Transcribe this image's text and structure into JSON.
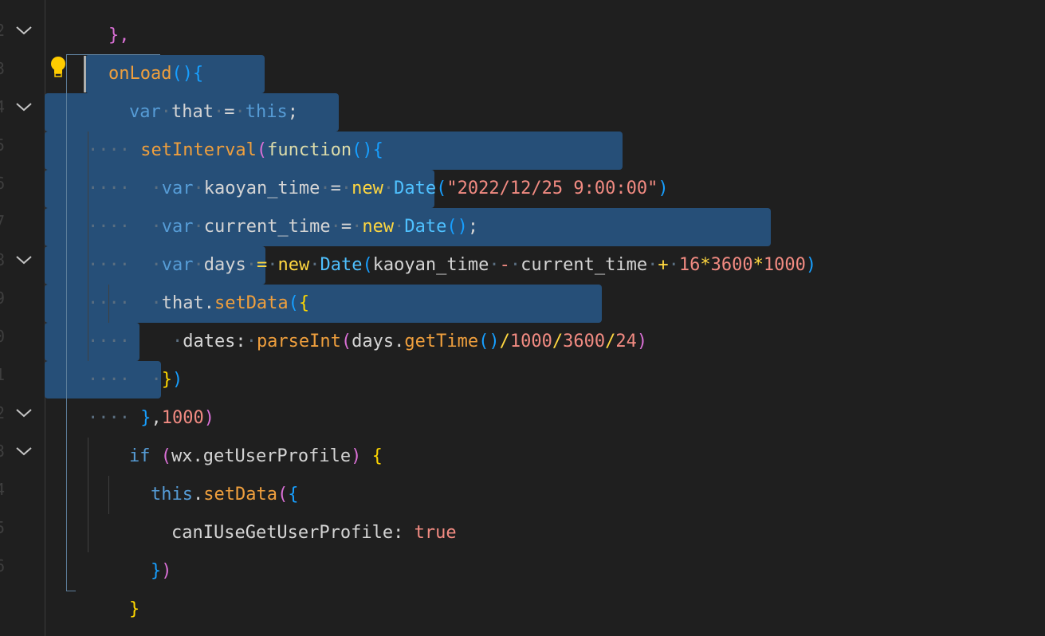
{
  "editor": {
    "language": "javascript",
    "line_numbers": [
      "2",
      "3",
      "4",
      "5",
      "6",
      "7",
      "8",
      "9",
      "0",
      "1",
      "2",
      "3",
      "4",
      "5",
      "6"
    ],
    "lines": [
      {
        "indent": 1,
        "text": "onLoad(){"
      },
      {
        "indent": 2,
        "text": "var that = this;"
      },
      {
        "indent": 2,
        "text": "setInterval(function(){"
      },
      {
        "indent": 3,
        "text": "var kaoyan_time = new Date(\"2022/12/25 9:00:00\")"
      },
      {
        "indent": 3,
        "text": "var current_time = new Date();"
      },
      {
        "indent": 3,
        "text": "var days = new Date(kaoyan_time - current_time + 16*3600*1000)"
      },
      {
        "indent": 3,
        "text": "that.setData({"
      },
      {
        "indent": 4,
        "text": "dates: parseInt(days.getTime()/1000/3600/24)"
      },
      {
        "indent": 3,
        "text": "})"
      },
      {
        "indent": 2,
        "text": "},1000)"
      },
      {
        "indent": 2,
        "text": "if (wx.getUserProfile) {"
      },
      {
        "indent": 3,
        "text": "this.setData({"
      },
      {
        "indent": 4,
        "text": "canIUseGetUserProfile: true"
      },
      {
        "indent": 3,
        "text": "})"
      },
      {
        "indent": 2,
        "text": "}"
      },
      {
        "indent": 1,
        "text": "},"
      }
    ],
    "top_partial": "},",
    "colors": {
      "background": "#1f1f1f",
      "selection": "#264f78",
      "keyword": "#569cd6",
      "function": "#dcdcaa",
      "method": "#ef9f3d",
      "string": "#f28b82",
      "number": "#f28b82",
      "class": "#4fc1ff",
      "new": "#ffd740",
      "bracket_level1": "#ffd700",
      "bracket_level2": "#da70d6",
      "bracket_level3": "#179fff"
    },
    "icons": {
      "fold": "chevron-down-icon",
      "lightbulb": "lightbulb-icon"
    }
  }
}
